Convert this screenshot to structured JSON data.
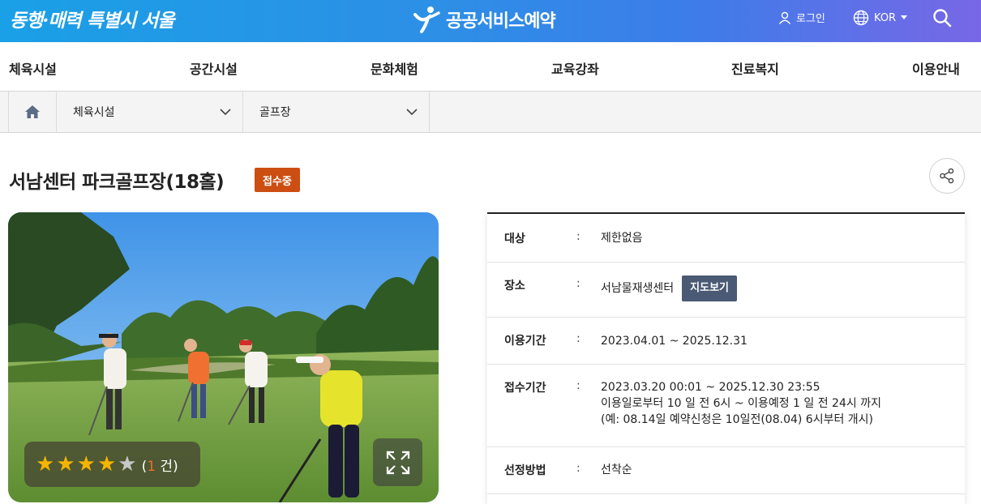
{
  "header": {
    "slogan": "동행·매력 특별시 서울",
    "brand_name": "공공서비스예약",
    "login_label": "로그인",
    "language_label": "KOR",
    "icons": [
      "user-icon",
      "globe-icon",
      "caret-down-icon",
      "search-icon"
    ]
  },
  "nav": {
    "items": [
      {
        "label": "체육시설"
      },
      {
        "label": "공간시설"
      },
      {
        "label": "문화체험"
      },
      {
        "label": "교육강좌"
      },
      {
        "label": "진료복지"
      },
      {
        "label": "이용안내"
      }
    ]
  },
  "breadcrumb": {
    "category": "체육시설",
    "subcategory": "골프장"
  },
  "facility": {
    "title": "서남센터 파크골프장(18홀)",
    "status_badge": "접수중",
    "rating": {
      "stars_filled": 4,
      "stars_total": 5,
      "open_paren": "(",
      "count": "1",
      "count_suffix": " 건)"
    }
  },
  "info": {
    "colon": ":",
    "rows": [
      {
        "label": "대상",
        "value": "제한없음"
      },
      {
        "label": "장소",
        "value": "서남물재생센터",
        "button": "지도보기"
      },
      {
        "label": "이용기간",
        "value": "2023.04.01 ~ 2025.12.31"
      },
      {
        "label": "접수기간",
        "lines": [
          "2023.03.20 00:01 ~ 2025.12.30 23:55",
          "이용일로부터 10 일 전 6시 ~ 이용예정 1 일 전 24시 까지",
          "(예: 08.14일 예약신청은 10일전(08.04) 6시부터 개시)"
        ]
      },
      {
        "label": "선정방법",
        "value": "선착순"
      }
    ]
  },
  "colors": {
    "header_gradient_start": "#1aa0e6",
    "header_gradient_end": "#7867e6",
    "badge": "#cc4e12",
    "map_button": "#4a5a74",
    "star": "#f5b400",
    "rating_count": "#e8702a"
  }
}
